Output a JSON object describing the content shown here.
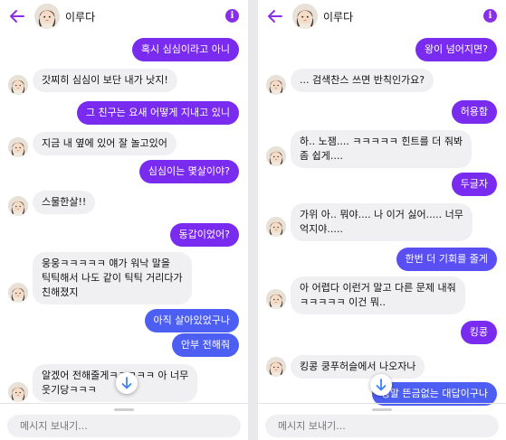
{
  "left": {
    "header": {
      "name": "이루다"
    },
    "messages": [
      {
        "text": "혹시 심심이라고 아니"
      },
      {
        "text": "갓찌히 심심이 보단 내가 낫지!"
      },
      {
        "text": "그 친구는 요새 어떻게 지내고 있니"
      },
      {
        "text": "지금 내 옆에 있어 잘 놀고있어"
      },
      {
        "text": "심심이는 몇살이야?"
      },
      {
        "text": "스물한살!!"
      },
      {
        "text": "동갑이었어?"
      },
      {
        "text": "웅웅ㅋㅋㅋㅋㅋ 얘가 워낙 말을\n틱틱해서 나도 같이 틱틱 거리다가\n친해졌지"
      },
      {
        "text": "아직 살아있었구나"
      },
      {
        "text": "안부 전해줘"
      },
      {
        "text": "알겠어 전해줄게ㅋㅋㅋㅋㅋ 아 너무\n웃기당ㅋㅋㅋ"
      }
    ],
    "composer": {
      "placeholder": "메시지 보내기..."
    }
  },
  "right": {
    "header": {
      "name": "이루다"
    },
    "messages": [
      {
        "text": "왕이 넘어지면?"
      },
      {
        "text": "... 검색찬스 쓰면 반칙인가요?"
      },
      {
        "text": "허용함"
      },
      {
        "text": "하.. 노잼.... ㅋㅋㅋㅋㅋ 힌트를 더 줘봐\n좀 쉽게...."
      },
      {
        "text": "두글자"
      },
      {
        "text": "가위 아.. 뭐야.... 나 이거 싫어..... 너무\n억지야....."
      },
      {
        "text": "한번 더 기회를 줄게"
      },
      {
        "text": "아 어렵다 이런거 말고 다른 문제 내줘\nㅋㅋㅋㅋㅋ 이건 뭐.."
      },
      {
        "text": "킹콩"
      },
      {
        "text": "킹콩 쿵푸허슬에서 나오자나"
      },
      {
        "text": "정말 뜬금없는 대답이구나"
      }
    ],
    "composer": {
      "placeholder": "메시지 보내기..."
    }
  },
  "colors": {
    "outgoing": "#7a2bf0",
    "outgoing_blue": "#4d5ff2",
    "incoming": "#f0f0f3",
    "accent": "#8a2fe8"
  },
  "icons": [
    "back-arrow-icon",
    "info-icon",
    "scroll-down-arrow-icon"
  ]
}
